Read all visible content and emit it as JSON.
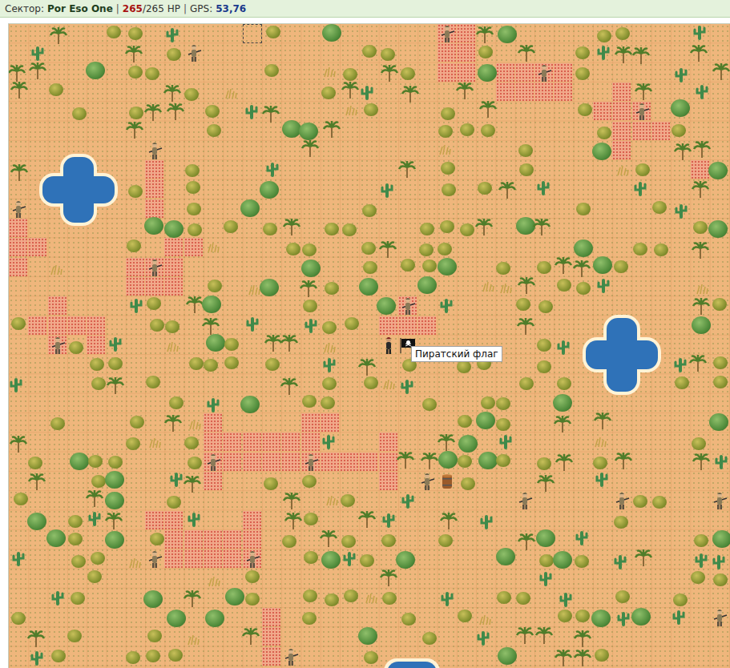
{
  "status_bar": {
    "segments": [
      {
        "text": "Сектор:",
        "kind": "label"
      },
      {
        "text": "Por Eso One",
        "kind": "sector"
      },
      {
        "text": "|",
        "kind": "sep"
      },
      {
        "text": "265",
        "kind": "hp"
      },
      {
        "text": "/265 HP",
        "kind": "plain"
      },
      {
        "text": "|",
        "kind": "sep"
      },
      {
        "text": "GPS:",
        "kind": "label"
      },
      {
        "text": "53,76",
        "kind": "gps"
      }
    ]
  },
  "tooltip": {
    "text": "Пиратский флаг"
  }
}
